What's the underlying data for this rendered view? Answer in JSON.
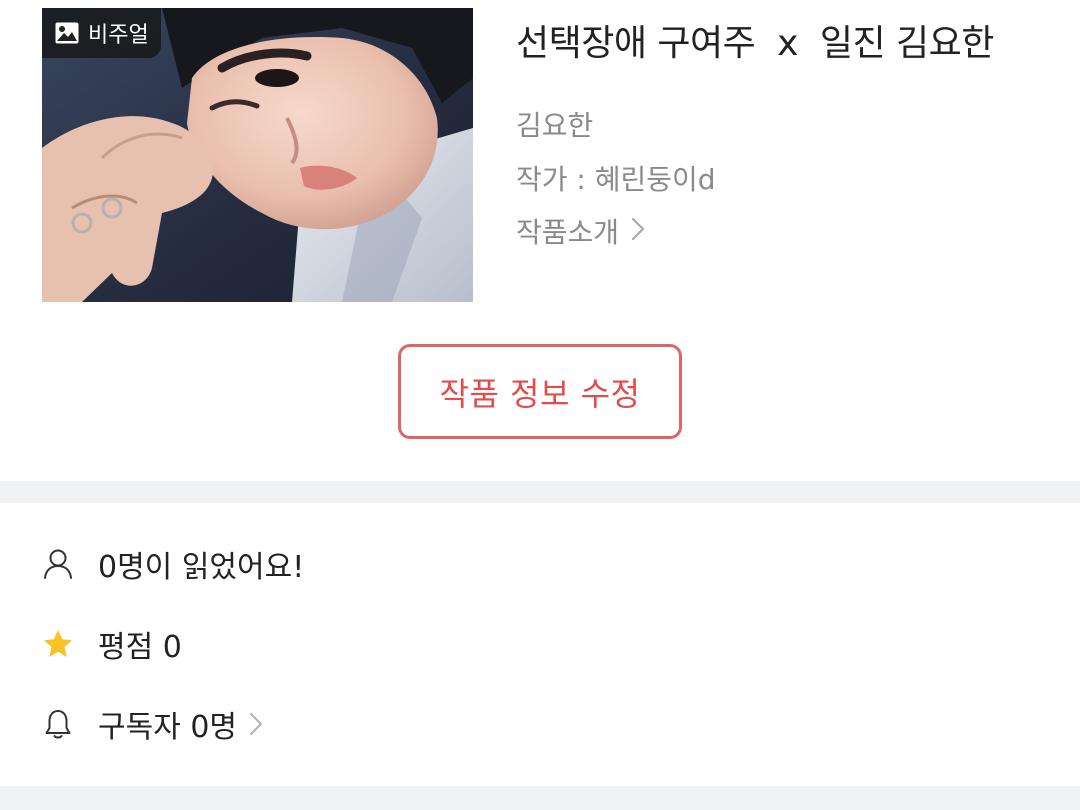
{
  "work": {
    "title": "선택장애 구여주  x  일진 김요한",
    "character": "김요한",
    "author_line": "작가 : 혜린둥이d",
    "synopsis_label": "작품소개"
  },
  "cover": {
    "badge_label": "비주얼"
  },
  "actions": {
    "edit_label": "작품 정보 수정"
  },
  "stats": {
    "readers_text": "0명이 읽었어요!",
    "rating_text": "평점 0",
    "subscribers_text": "구독자 0명"
  },
  "icons": {
    "badge": "image-icon",
    "synopsis": "chevron-right-icon",
    "readers": "person-icon",
    "rating": "star-icon",
    "subscribers": "bell-icon"
  },
  "colors": {
    "accent": "#e44b4b",
    "accent_border": "#e06666",
    "star": "#f7c325",
    "text_primary": "#222222",
    "text_secondary": "#8a8a8a",
    "divider": "#f0f1f3"
  }
}
